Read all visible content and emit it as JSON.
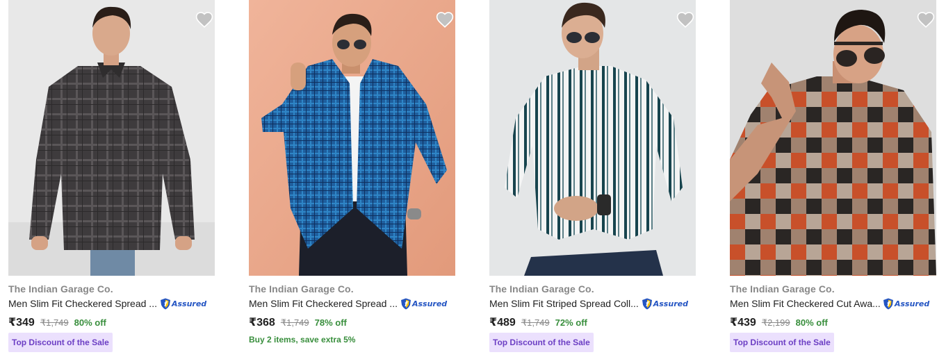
{
  "products": [
    {
      "brand": "The Indian Garage Co.",
      "title": "Men Slim Fit Checkered Spread ...",
      "assured_label": "Assured",
      "price": "₹349",
      "mrp": "₹1,749",
      "discount": "80% off",
      "badge": "Top Discount of the Sale",
      "offer": "",
      "image_icon": "shirt-photo-dark-grey-checked"
    },
    {
      "brand": "The Indian Garage Co.",
      "title": "Men Slim Fit Checkered Spread ...",
      "assured_label": "Assured",
      "price": "₹368",
      "mrp": "₹1,749",
      "discount": "78% off",
      "badge": "",
      "offer": "Buy 2 items, save extra 5%",
      "image_icon": "shirt-photo-blue-checked"
    },
    {
      "brand": "The Indian Garage Co.",
      "title": "Men Slim Fit Striped Spread Coll...",
      "assured_label": "Assured",
      "price": "₹489",
      "mrp": "₹1,749",
      "discount": "72% off",
      "badge": "Top Discount of the Sale",
      "offer": "",
      "image_icon": "shirt-photo-white-striped"
    },
    {
      "brand": "The Indian Garage Co.",
      "title": "Men Slim Fit Checkered Cut Awa...",
      "assured_label": "Assured",
      "price": "₹439",
      "mrp": "₹2,199",
      "discount": "80% off",
      "badge": "Top Discount of the Sale",
      "offer": "",
      "image_icon": "shirt-photo-orange-checked"
    }
  ],
  "colors": {
    "brand_text": "#878787",
    "discount_green": "#388e3c",
    "badge_bg": "#ebe0fd",
    "badge_text": "#6c3fc4",
    "assured_blue": "#2455c3",
    "wishlist_heart": "#c2c2c2"
  }
}
